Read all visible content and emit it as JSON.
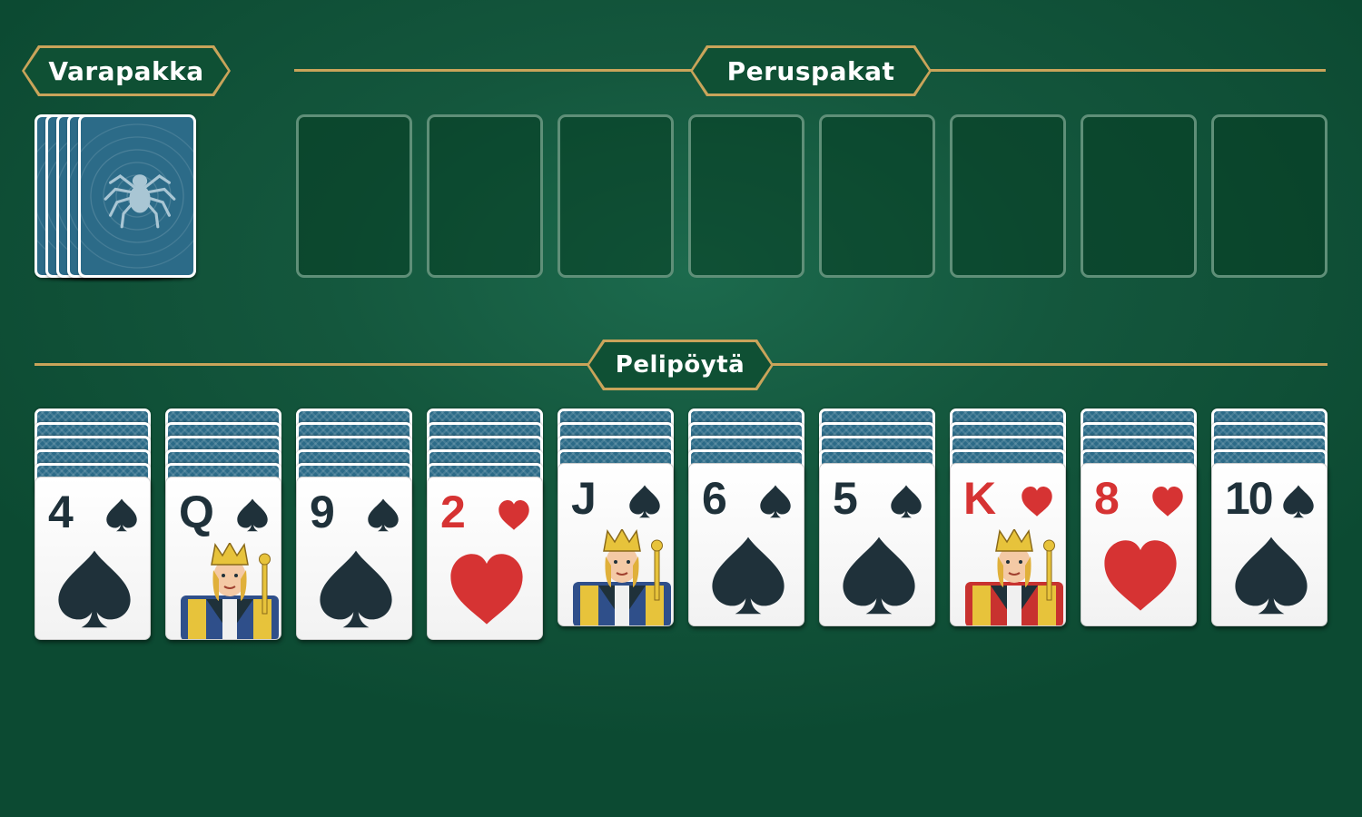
{
  "labels": {
    "stock": "Varapakka",
    "foundations": "Peruspakat",
    "tableau": "Pelipöytä"
  },
  "stock": {
    "cards": 5,
    "icon": "spider-icon"
  },
  "foundations": {
    "empty_slots": 8
  },
  "colors": {
    "felt": "#14573d",
    "gold": "#c9a45a",
    "card_back": "#2c6b88",
    "black_suit": "#1f313a",
    "red_suit": "#d63333"
  },
  "tableau": {
    "columns": [
      {
        "hidden": 5,
        "rank": "4",
        "suit": "spades"
      },
      {
        "hidden": 5,
        "rank": "Q",
        "suit": "spades"
      },
      {
        "hidden": 5,
        "rank": "9",
        "suit": "spades"
      },
      {
        "hidden": 5,
        "rank": "2",
        "suit": "hearts"
      },
      {
        "hidden": 4,
        "rank": "J",
        "suit": "spades"
      },
      {
        "hidden": 4,
        "rank": "6",
        "suit": "spades"
      },
      {
        "hidden": 4,
        "rank": "5",
        "suit": "spades"
      },
      {
        "hidden": 4,
        "rank": "K",
        "suit": "hearts"
      },
      {
        "hidden": 4,
        "rank": "8",
        "suit": "hearts"
      },
      {
        "hidden": 4,
        "rank": "10",
        "suit": "spades"
      }
    ]
  }
}
